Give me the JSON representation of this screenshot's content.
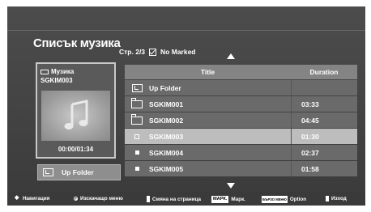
{
  "header": {
    "title": "Списък музика",
    "page_info": "Стр. 2/3",
    "marked_label": "No Marked"
  },
  "preview": {
    "folder_label": "Музика",
    "file_name": "SGKIM003",
    "icon": "music-note-icon",
    "timecode": "00:00/01:34"
  },
  "up_folder_button": {
    "label": "Up Folder"
  },
  "list": {
    "columns": {
      "title": "Title",
      "duration": "Duration"
    },
    "rows": [
      {
        "type": "up-folder",
        "icon": "up-folder-icon",
        "title": "Up Folder",
        "duration": ""
      },
      {
        "type": "folder",
        "icon": "folder-icon",
        "title": "SGKIM001",
        "duration": "03:33"
      },
      {
        "type": "folder",
        "icon": "folder-icon",
        "title": "SGKIM002",
        "duration": "04:45"
      },
      {
        "type": "file",
        "icon": "file-icon",
        "title": "SGKIM003",
        "duration": "01:30",
        "selected": true
      },
      {
        "type": "file",
        "icon": "file-icon",
        "title": "SGKIM004",
        "duration": "02:37"
      },
      {
        "type": "file",
        "icon": "file-icon",
        "title": "SGKIM005",
        "duration": "01:58"
      }
    ]
  },
  "footer": {
    "navigation": "Навигация",
    "popup_menu": "Изскачащо меню",
    "page_change": "Смяна на страница",
    "mark_key": "МАРК.",
    "mark_label": "Марк.",
    "quick_menu_key": "БЪРЗО МЕНЮ",
    "option_label": "Option",
    "exit_label": "Изход"
  },
  "colors": {
    "background": "#444444",
    "row": "#6a6a6a",
    "row_selected": "#bdbdbd",
    "header_row": "#848484"
  }
}
